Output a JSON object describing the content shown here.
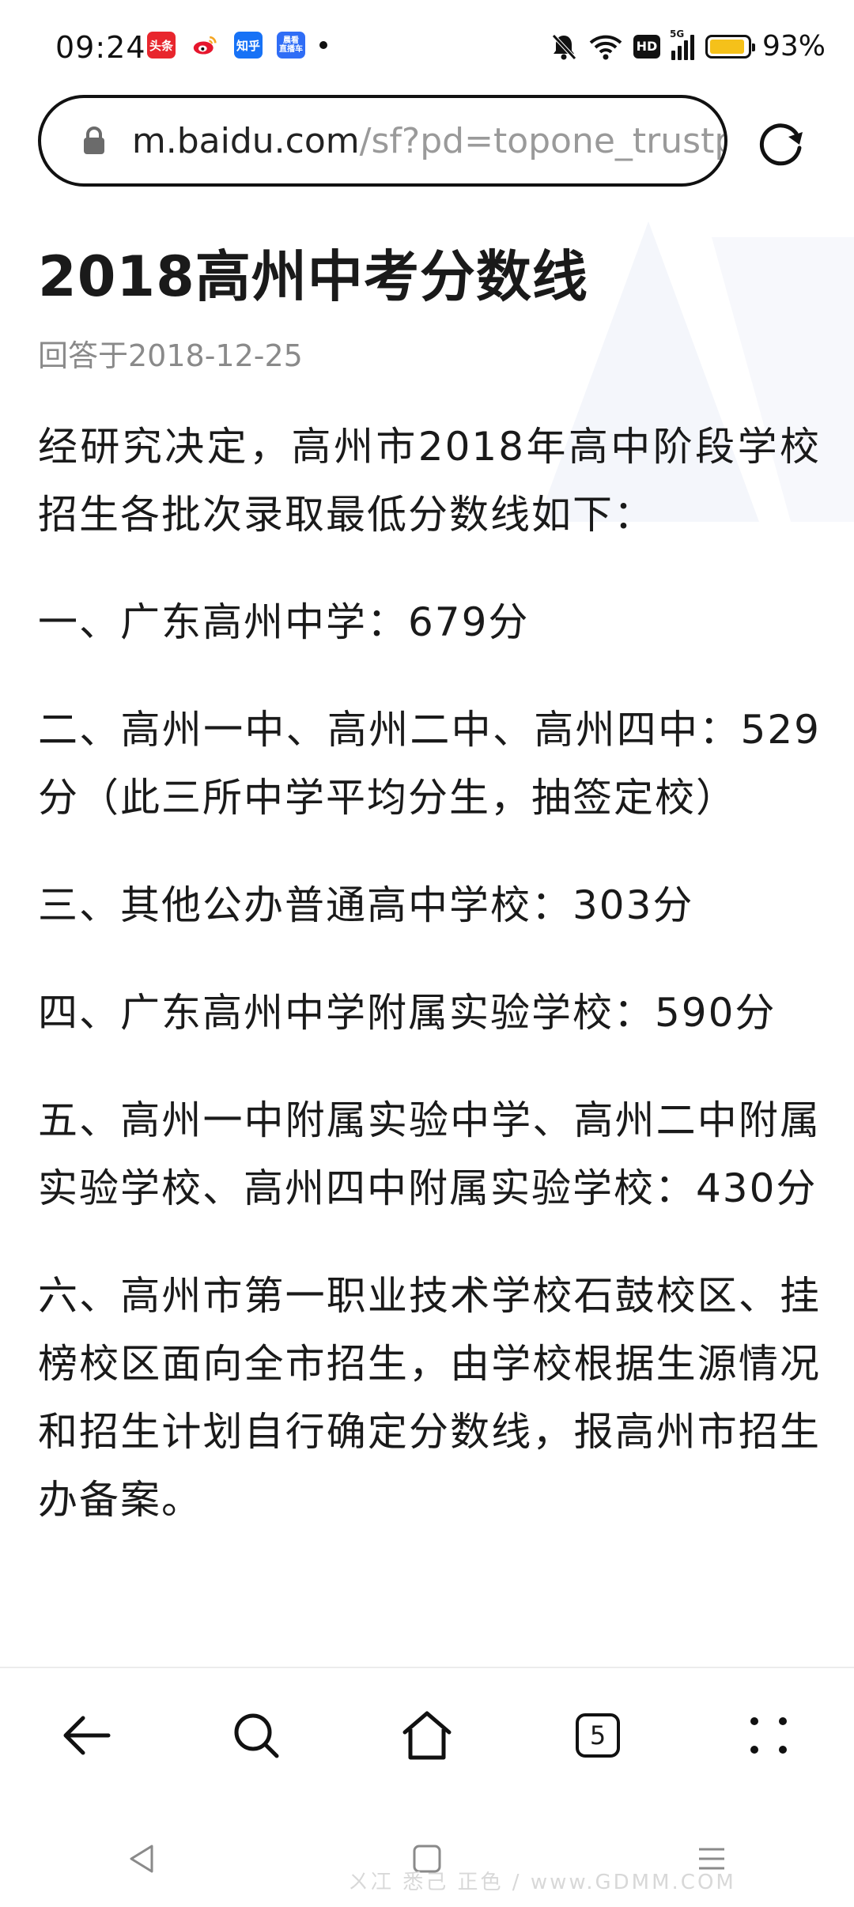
{
  "status_bar": {
    "time": "09:24",
    "apps": [
      {
        "name": "toutiao-app-icon",
        "label": "头条"
      },
      {
        "name": "weibo-app-icon",
        "label": ""
      },
      {
        "name": "zhihu-app-icon",
        "label": "知乎"
      },
      {
        "name": "news-app-icon",
        "label": "晨看\n直播车"
      }
    ],
    "hd_label": "HD",
    "network_label": "5G",
    "battery_level": 0.93,
    "battery_percent": "93%"
  },
  "browser": {
    "url_domain": "m.baidu.com",
    "url_path": "/sf?pd=topone_trustp"
  },
  "article": {
    "title": "2018高州中考分数线",
    "date": "回答于2018-12-25",
    "paragraphs": [
      "经研究决定，高州市2018年高中阶段学校招生各批次录取最低分数线如下：",
      "一、广东高州中学：679分",
      "二、高州一中、高州二中、高州四中：529分（此三所中学平均分生，抽签定校）",
      "三、其他公办普通高中学校：303分",
      "四、广东高州中学附属实验学校：590分",
      "五、高州一中附属实验中学、高州二中附属实验学校、高州四中附属实验学校：430分",
      "六、高州市第一职业技术学校石鼓校区、挂榜校区面向全市招生，由学校根据生源情况和招生计划自行确定分数线，报高州市招生办备案。"
    ]
  },
  "bottom_nav": {
    "tab_count": "5"
  },
  "watermark": "ㄨ冮 悉己 正色 / www.GDMM.COM"
}
